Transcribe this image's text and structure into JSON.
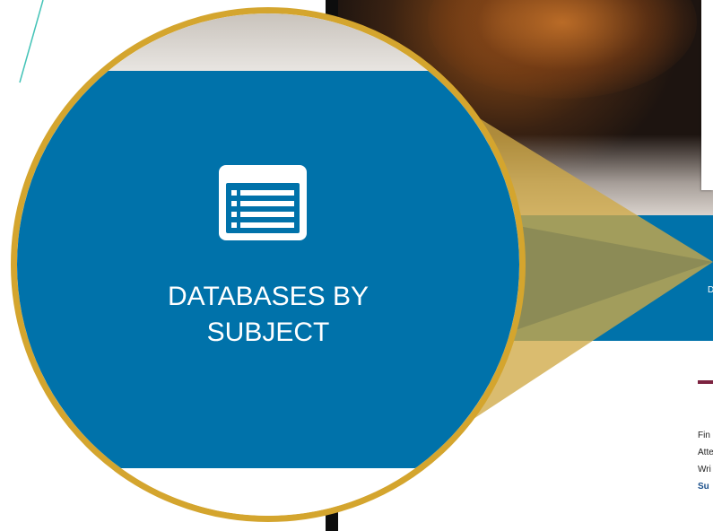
{
  "circle": {
    "icon": "list-icon",
    "label": "DATABASES BY\nSUBJECT"
  },
  "band": {
    "partial_letter": "D"
  },
  "content_lines": [
    "Fin",
    "Atte",
    "Wri",
    "Su"
  ],
  "colors": {
    "ring": "#d4a52e",
    "blue": "#0072aa",
    "accent": "#7c2340",
    "cone": "#cfa946",
    "line": "#43c3b7"
  }
}
